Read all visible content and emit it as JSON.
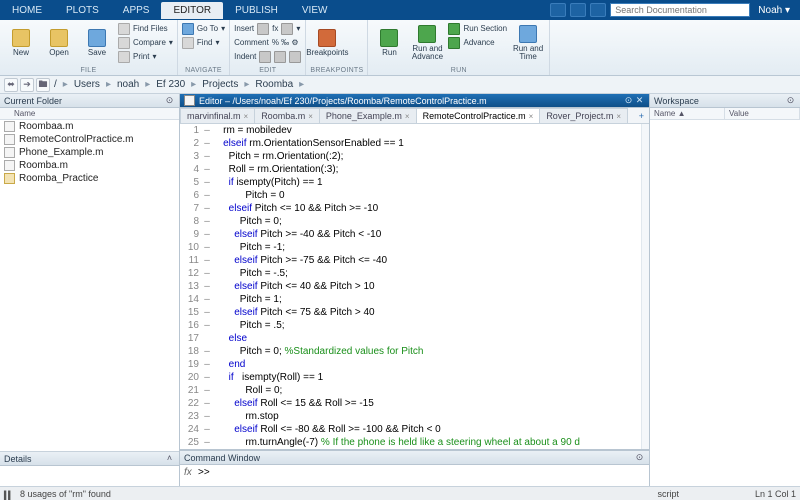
{
  "menu": {
    "tabs": [
      "HOME",
      "PLOTS",
      "APPS",
      "EDITOR",
      "PUBLISH",
      "VIEW"
    ],
    "active_index": 3,
    "search_placeholder": "Search Documentation",
    "user": "Noah"
  },
  "ribbon": {
    "file": {
      "title": "FILE",
      "new": "New",
      "open": "Open",
      "save": "Save",
      "find_files": "Find Files",
      "compare": "Compare",
      "print": "Print"
    },
    "navigate": {
      "title": "NAVIGATE",
      "goto": "Go To",
      "find": "Find"
    },
    "edit": {
      "title": "EDIT",
      "insert": "Insert",
      "fx": "fx",
      "comment": "Comment",
      "indent": "Indent"
    },
    "breakpoints": {
      "title": "BREAKPOINTS",
      "btn": "Breakpoints"
    },
    "run": {
      "title": "RUN",
      "run": "Run",
      "run_and_advance": "Run and\nAdvance",
      "run_section": "Run Section",
      "advance": "Advance",
      "run_and_time": "Run and\nTime"
    }
  },
  "path": {
    "crumbs": [
      "/",
      "Users",
      "noah",
      "Ef 230",
      "Projects",
      "Roomba"
    ]
  },
  "current_folder": {
    "title": "Current Folder",
    "col": "Name",
    "items": [
      {
        "name": "Roombaa.m",
        "type": "file"
      },
      {
        "name": "RemoteControlPractice.m",
        "type": "file"
      },
      {
        "name": "Phone_Example.m",
        "type": "file"
      },
      {
        "name": "Roomba.m",
        "type": "file"
      },
      {
        "name": "Roomba_Practice",
        "type": "folder"
      }
    ],
    "details_title": "Details"
  },
  "editor": {
    "title": "Editor – /Users/noah/Ef 230/Projects/Roomba/RemoteControlPractice.m",
    "tabs": [
      {
        "label": "marvinfinal.m",
        "active": false
      },
      {
        "label": "Roomba.m",
        "active": false
      },
      {
        "label": "Phone_Example.m",
        "active": false
      },
      {
        "label": "RemoteControlPractice.m",
        "active": true
      },
      {
        "label": "Rover_Project.m",
        "active": false
      }
    ]
  },
  "cmd": {
    "title": "Command Window",
    "prompt": ">>"
  },
  "workspace": {
    "title": "Workspace",
    "cols": [
      "Name ▲",
      "Value"
    ]
  },
  "status": {
    "usages": "8 usages of \"rm\" found",
    "mode": "script",
    "pos": "Ln  1   Col  1"
  }
}
